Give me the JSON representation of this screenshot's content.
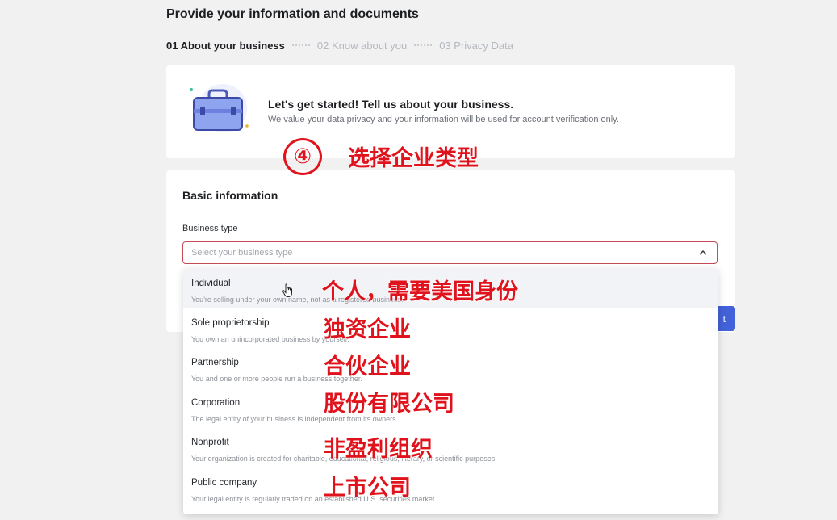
{
  "header": {
    "title": "Provide your information and documents",
    "steps": [
      {
        "label": "01 About your business",
        "active": true
      },
      {
        "label": "02 Know about you",
        "active": false
      },
      {
        "label": "03 Privacy Data",
        "active": false
      }
    ]
  },
  "intro": {
    "icon": "briefcase-icon",
    "title": "Let's get started! Tell us about your business.",
    "subtitle": "We value your data privacy and your information will be used for account verification only."
  },
  "basic_info": {
    "title": "Basic information",
    "business_type_label": "Business type",
    "business_type_placeholder": "Select your business type",
    "next_button": "t"
  },
  "dropdown": {
    "options": [
      {
        "label": "Individual",
        "desc": "You're selling under your own name, not as a registered business."
      },
      {
        "label": "Sole proprietorship",
        "desc": "You own an unincorporated business by yourself."
      },
      {
        "label": "Partnership",
        "desc": "You and one or more people run a business together."
      },
      {
        "label": "Corporation",
        "desc": "The legal entity of your business is independent from its owners."
      },
      {
        "label": "Nonprofit",
        "desc": "Your organization is created for charitable, educational, religious, literary, or scientific purposes."
      },
      {
        "label": "Public company",
        "desc": "Your legal entity is regularly traded on an established U.S. securities market."
      }
    ]
  },
  "annotations": {
    "step_number": "④",
    "heading": "选择企业类型",
    "labels": [
      "个人，需要美国身份",
      "独资企业",
      "合伙企业",
      "股份有限公司",
      "非盈利组织",
      "上市公司"
    ]
  },
  "colors": {
    "accent": "#4361d8",
    "annotation_red": "#e0121b",
    "select_border": "#c44a55"
  }
}
